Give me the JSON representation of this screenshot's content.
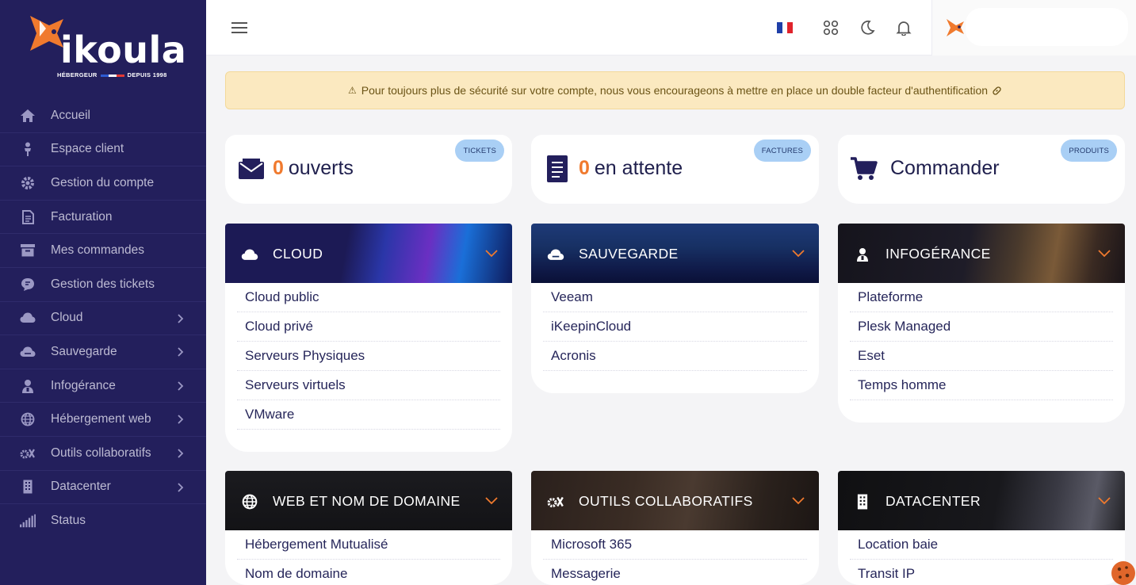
{
  "brand": {
    "name": "ikoula",
    "tagline_left": "HÉBERGEUR",
    "tagline_right": "DEPUIS 1998"
  },
  "sidebar": {
    "items": [
      {
        "label": "Accueil",
        "icon": "home-icon",
        "has_submenu": false
      },
      {
        "label": "Espace client",
        "icon": "user-icon",
        "has_submenu": false
      },
      {
        "label": "Gestion du compte",
        "icon": "gear-icon",
        "has_submenu": false
      },
      {
        "label": "Facturation",
        "icon": "document-icon",
        "has_submenu": false
      },
      {
        "label": "Mes commandes",
        "icon": "archive-icon",
        "has_submenu": false
      },
      {
        "label": "Gestion des tickets",
        "icon": "chat-icon",
        "has_submenu": false
      },
      {
        "label": "Cloud",
        "icon": "cloud-icon",
        "has_submenu": true
      },
      {
        "label": "Sauvegarde",
        "icon": "cloud-backup-icon",
        "has_submenu": true
      },
      {
        "label": "Infogérance",
        "icon": "support-agent-icon",
        "has_submenu": true
      },
      {
        "label": "Hébergement web",
        "icon": "globe-icon",
        "has_submenu": true
      },
      {
        "label": "Outils collaboratifs",
        "icon": "tools-icon",
        "has_submenu": true
      },
      {
        "label": "Datacenter",
        "icon": "building-icon",
        "has_submenu": true
      },
      {
        "label": "Status",
        "icon": "signal-bars-icon",
        "has_submenu": false
      }
    ]
  },
  "topbar": {
    "language": "FR",
    "user_name": ""
  },
  "alert": {
    "text": "Pour toujours plus de sécurité sur votre compte, nous vous encourageons à mettre en place un double facteur d'authentification"
  },
  "summary": [
    {
      "badge": "TICKETS",
      "count": "0",
      "label": "ouverts",
      "icon": "envelope-icon"
    },
    {
      "badge": "FACTURES",
      "count": "0",
      "label": "en attente",
      "icon": "invoice-icon"
    },
    {
      "badge": "PRODUITS",
      "count": "",
      "label": "Commander",
      "icon": "cart-icon"
    }
  ],
  "services": [
    {
      "title": "CLOUD",
      "icon": "cloud-icon",
      "items": [
        "Cloud public",
        "Cloud privé",
        "Serveurs Physiques",
        "Serveurs virtuels",
        "VMware"
      ]
    },
    {
      "title": "SAUVEGARDE",
      "icon": "cloud-backup-icon",
      "items": [
        "Veeam",
        "iKeepinCloud",
        "Acronis"
      ]
    },
    {
      "title": "INFOGÉRANCE",
      "icon": "support-agent-icon",
      "items": [
        "Plateforme",
        "Plesk Managed",
        "Eset",
        "Temps homme"
      ]
    },
    {
      "title": "WEB ET NOM DE DOMAINE",
      "icon": "globe-icon",
      "items": [
        "Hébergement Mutualisé",
        "Nom de domaine"
      ]
    },
    {
      "title": "OUTILS COLLABORATIFS",
      "icon": "tools-icon",
      "items": [
        "Microsoft 365",
        "Messagerie"
      ]
    },
    {
      "title": "DATACENTER",
      "icon": "building-icon",
      "items": [
        "Location baie",
        "Transit IP"
      ]
    }
  ],
  "colors": {
    "sidebar_bg": "#231f5c",
    "accent_orange": "#f07a2e",
    "badge_blue": "#a9cff5",
    "alert_bg": "#fbe9c0",
    "text_dark": "#1f1f4d"
  }
}
